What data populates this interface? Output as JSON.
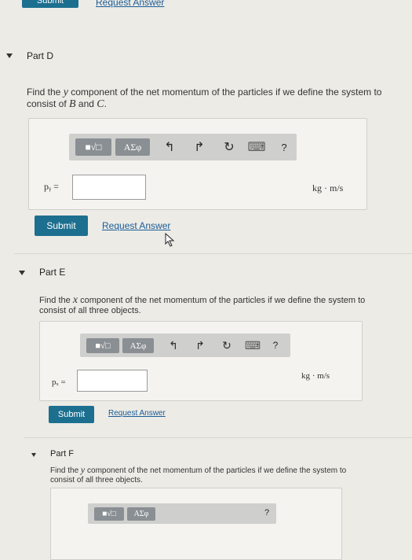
{
  "top": {
    "submit_label": "Submit",
    "request_label": "Request Answer"
  },
  "part_d": {
    "title": "Part D",
    "question_pre": "Find the ",
    "question_var": "y",
    "question_mid": " component of the net momentum of the particles if we define the system to consist of ",
    "question_b": "B",
    "question_and": " and ",
    "question_c": "C",
    "question_end": ".",
    "toolbar": {
      "templates": "■√□",
      "greek": "ΑΣφ",
      "undo": "↰",
      "redo": "↱",
      "reset": "↻",
      "keyboard": "⌨",
      "help": "?"
    },
    "variable_label": "pᵧ =",
    "unit": "kg · m/s",
    "submit_label": "Submit",
    "request_label": "Request Answer"
  },
  "part_e": {
    "title": "Part E",
    "question_pre": "Find the ",
    "question_var": "x",
    "question_mid": " component of the net momentum of the particles if we define the system to consist of all three objects.",
    "toolbar": {
      "templates": "■√□",
      "greek": "ΑΣφ",
      "undo": "↰",
      "redo": "↱",
      "reset": "↻",
      "keyboard": "⌨",
      "help": "?"
    },
    "variable_label": "pₓ =",
    "unit": "kg · m/s",
    "submit_label": "Submit",
    "request_label": "Request Answer"
  },
  "part_f": {
    "title": "Part F",
    "question_pre": "Find the ",
    "question_var": "y",
    "question_mid": " component of the net momentum of the particles if we define the system to consist of all three objects.",
    "toolbar": {
      "templates": "■√□",
      "greek": "ΑΣφ",
      "help": "?"
    }
  }
}
